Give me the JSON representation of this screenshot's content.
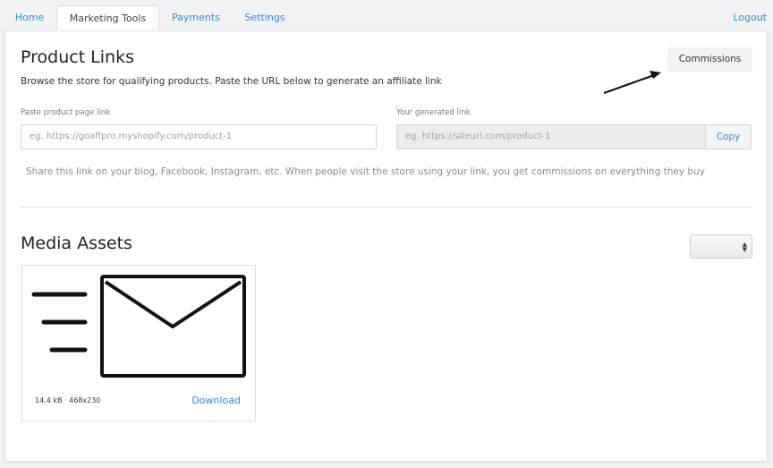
{
  "nav": {
    "tabs": [
      {
        "label": "Home"
      },
      {
        "label": "Marketing Tools"
      },
      {
        "label": "Payments"
      },
      {
        "label": "Settings"
      }
    ],
    "logout": "Logout"
  },
  "product_links": {
    "title": "Product Links",
    "subtitle": "Browse the store for qualifying products. Paste the URL below to generate an affiliate link",
    "commissions_button": "Commissions",
    "paste_label": "Paste product page link",
    "paste_placeholder": "eg. https://goaffpro.myshopify.com/product-1",
    "generated_label": "Your generated link",
    "generated_placeholder": "eg. https://siteurl.com/product-1",
    "copy_button": "Copy",
    "share_text": "Share this link on your blog, Facebook, Instagram, etc. When people visit the store using your link, you get commissions on everything they buy"
  },
  "media_assets": {
    "title": "Media Assets",
    "select_value": "",
    "assets": [
      {
        "meta": "14.4 kB · 468x230",
        "download": "Download",
        "icon": "email-icon"
      }
    ]
  },
  "colors": {
    "link": "#3a86d4",
    "background": "#f1f2f4",
    "card": "#ffffff"
  }
}
